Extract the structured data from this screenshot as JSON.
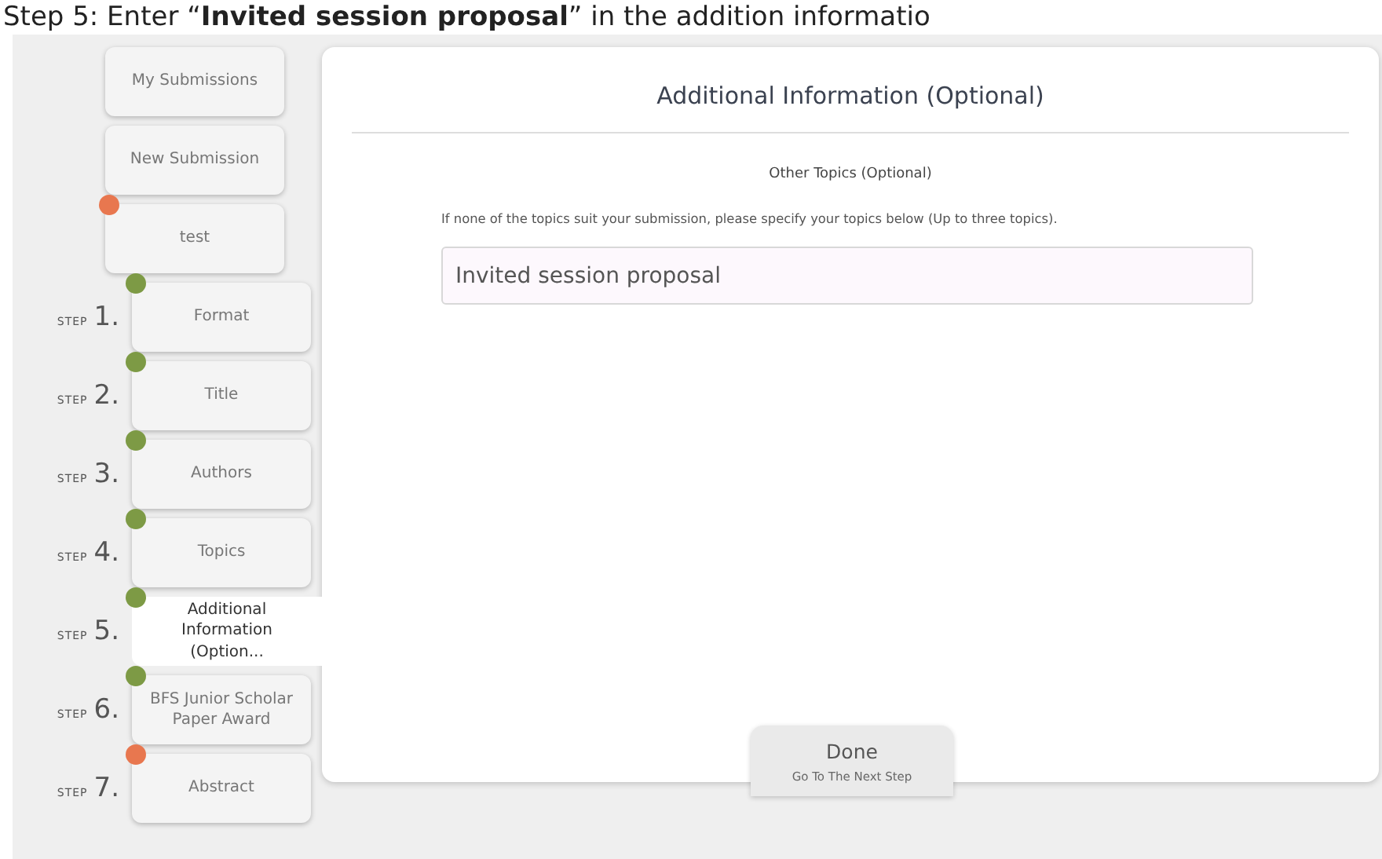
{
  "caption": "Step 5: Enter “**Invited session proposal**” in the addition informatio",
  "sidebar": {
    "items": [
      {
        "kind": "nav",
        "label": "My Submissions",
        "selected": false
      },
      {
        "kind": "nav",
        "label": "New Submission",
        "selected": false
      },
      {
        "kind": "nav",
        "label": "test",
        "selected": false,
        "color": "#e8774f"
      },
      {
        "kind": "step",
        "step_word": "STEP",
        "number": "1.",
        "label": "Format",
        "selected": false,
        "color": "#7d9a45"
      },
      {
        "kind": "step",
        "step_word": "STEP",
        "number": "2.",
        "label": "Title",
        "selected": false,
        "color": "#7d9a45"
      },
      {
        "kind": "step",
        "step_word": "STEP",
        "number": "3.",
        "label": "Authors",
        "selected": false,
        "color": "#7d9a45"
      },
      {
        "kind": "step",
        "step_word": "STEP",
        "number": "4.",
        "label": "Topics",
        "selected": false,
        "color": "#7d9a45"
      },
      {
        "kind": "step",
        "step_word": "STEP",
        "number": "5.",
        "label": "Additional Information (Option...",
        "selected": true,
        "color": "#7d9a45"
      },
      {
        "kind": "step",
        "step_word": "STEP",
        "number": "6.",
        "label": "BFS Junior Scholar Paper Award",
        "selected": false,
        "color": "#7d9a45"
      },
      {
        "kind": "step",
        "step_word": "STEP",
        "number": "7.",
        "label": "Abstract",
        "selected": false,
        "color": "#e8774f"
      }
    ]
  },
  "panel": {
    "title": "Additional Information (Optional)",
    "section_title": "Other Topics (Optional)",
    "instructions": "If none of the topics suit your submission, please specify your topics below (Up to three topics).",
    "topic_field": {
      "value": "Invited session proposal"
    }
  },
  "done_button": {
    "label": "Done",
    "sublabel": "Go To The Next Step"
  }
}
